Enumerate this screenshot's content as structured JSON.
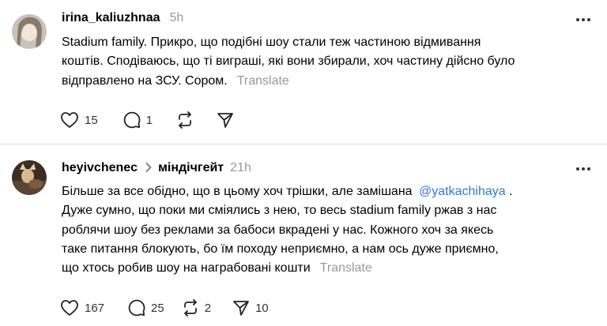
{
  "posts": [
    {
      "username": "irina_kaliuzhnaa",
      "time": "5h",
      "body_lines": [
        "Stadium family. Прикро, що подібні шоу стали теж частиною відмивання",
        "коштів. Сподіваюсь, що ті виграші, які вони збирали, хоч частину дійсно було",
        "відправлено на ЗСУ. Сором."
      ],
      "translate": "Translate",
      "likes": "15",
      "replies": "1"
    },
    {
      "username": "heyivchenec",
      "thread": "міндічгейт",
      "time": "21h",
      "body_lines": [
        "Більше за все обідно, що в цьому хоч трішки, але замішана",
        "Дуже сумно, що поки ми сміялись з нею, то весь stadium family ржав з нас",
        "роблячи шоу без реклами за бабоси вкрадені у нас. Кожного хоч за якесь",
        "таке питання блокують, бо їм походу неприємно, а нам ось дуже приємно,",
        "що хтось робив шоу на награбовані кошти"
      ],
      "mention": "@yatkachihaya",
      "mention_suffix": " .",
      "translate": "Translate",
      "likes": "167",
      "replies": "25",
      "reposts": "2",
      "shares": "10"
    }
  ],
  "icons": {
    "more": "more-horizontal-icon",
    "like": "heart-icon",
    "reply": "comment-icon",
    "repost": "repost-icon",
    "share": "send-icon",
    "thread": "chevron-right-icon"
  },
  "colors": {
    "muted": "#999999",
    "mention": "#2e7ad8",
    "divider": "#dcdcdc"
  }
}
